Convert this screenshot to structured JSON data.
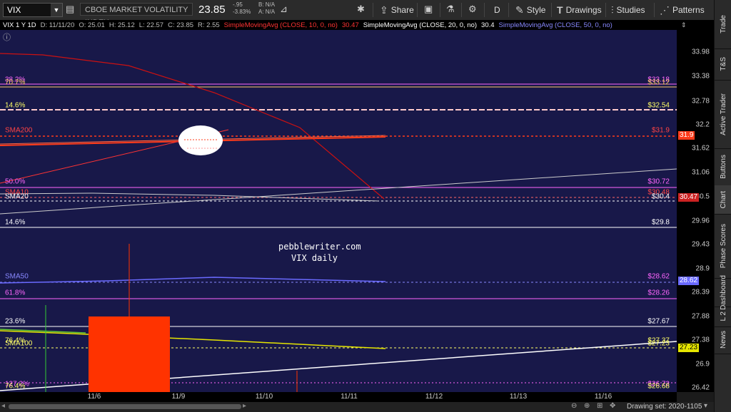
{
  "toolbar": {
    "symbol": "VIX",
    "description": "CBOE MARKET VOLATILITY INDEX",
    "last": "23.85",
    "change": "-.95",
    "change_pct": "-3.83%",
    "bid": "B: N/A",
    "ask": "A: N/A",
    "share_label": "Share",
    "aggregation": "D",
    "style_label": "Style",
    "drawings_label": "Drawings",
    "studies_label": "Studies",
    "patterns_label": "Patterns"
  },
  "infobar": {
    "chart_label": "VIX 1 Y 1D",
    "date": "D: 11/11/20",
    "open": "O: 25.01",
    "high": "H: 25.12",
    "low": "L: 22.57",
    "close": "C: 23.85",
    "range": "R: 2.55",
    "sma10_label": "SimpleMovingAvg (CLOSE, 10, 0, no)",
    "sma10_value": "30.47",
    "sma20_label": "SimpleMovingAvg (CLOSE, 20, 0, no)",
    "sma20_value": "30.4",
    "sma50_label": "SimpleMovingAvg (CLOSE, 50, 0, no)"
  },
  "yaxis": {
    "ticks": [
      "33.98",
      "33.38",
      "32.78",
      "32.2",
      "31.62",
      "31.06",
      "30.5",
      "29.96",
      "29.43",
      "28.9",
      "28.39",
      "27.88",
      "27.38",
      "26.9",
      "26.42"
    ],
    "badges": [
      {
        "text": "31.9",
        "bg": "#ff3b1a",
        "fg": "#ffffff"
      },
      {
        "text": "30.47",
        "bg": "#cc2222",
        "fg": "#ffffff"
      },
      {
        "text": "28.62",
        "bg": "#6a6aff",
        "fg": "#ffffff"
      },
      {
        "text": "27.23",
        "bg": "#e6e600",
        "fg": "#000000"
      }
    ]
  },
  "xaxis": {
    "ticks": [
      "11/6",
      "11/9",
      "11/10",
      "11/11",
      "11/12",
      "11/13",
      "11/16"
    ]
  },
  "levels": {
    "left": [
      {
        "text": "38.2%",
        "color": "#ff66ff"
      },
      {
        "text": "70.7%",
        "color": "#ffcc66"
      },
      {
        "text": "14.6%",
        "color": "#ffff66"
      },
      {
        "text": "SMA200",
        "color": "#ff4444"
      },
      {
        "text": "50.0%",
        "color": "#ff66ff"
      },
      {
        "text": "SMA10",
        "color": "#ff4444"
      },
      {
        "text": "SMA20",
        "color": "#ffffff"
      },
      {
        "text": "14.6%",
        "color": "#ffffff"
      },
      {
        "text": "SMA50",
        "color": "#8888ff"
      },
      {
        "text": "61.8%",
        "color": "#ff66ff"
      },
      {
        "text": "23.6%",
        "color": "#ffffff"
      },
      {
        "text": "76.4%",
        "color": "#ffff66"
      },
      {
        "text": "SMA100",
        "color": "#ffff66"
      },
      {
        "text": "127.2%",
        "color": "#ff66ff"
      },
      {
        "text": "76.4%",
        "color": "#ffff66"
      }
    ],
    "right": [
      {
        "text": "$33.18",
        "color": "#ff66ff"
      },
      {
        "text": "$33.12",
        "color": "#ffcc66"
      },
      {
        "text": "$32.54",
        "color": "#ffff66"
      },
      {
        "text": "$31.9",
        "color": "#ff4444"
      },
      {
        "text": "$30.72",
        "color": "#ff66ff"
      },
      {
        "text": "$30.48",
        "color": "#ff4444"
      },
      {
        "text": "$30.4",
        "color": "#ffffff"
      },
      {
        "text": "$29.8",
        "color": "#ffffff"
      },
      {
        "text": "$28.62",
        "color": "#ff66ff"
      },
      {
        "text": "$28.26",
        "color": "#ff66ff"
      },
      {
        "text": "$27.67",
        "color": "#ffffff"
      },
      {
        "text": "$27.37",
        "color": "#ffff66"
      },
      {
        "text": "$27.23",
        "color": "#ffff66"
      },
      {
        "text": "$26.72",
        "color": "#ff66ff"
      },
      {
        "text": "$26.68",
        "color": "#ffff66"
      }
    ]
  },
  "watermark": {
    "line1": "pebblewriter.com",
    "line2": "VIX daily"
  },
  "bottom": {
    "drawing_set": "Drawing set: 2020-1105"
  },
  "side_tabs": [
    "Trade",
    "T&S",
    "Active Trader",
    "Buttons",
    "Chart",
    "Phase Scores",
    "Dashboard",
    "L 2",
    "News"
  ],
  "colors": {
    "plot_bg": "#181849",
    "candle": "#ff3300",
    "sma10": "#cc1111",
    "sma200": "#ff3b1a",
    "sma50": "#6a6aff",
    "sma100": "#e6e600"
  }
}
